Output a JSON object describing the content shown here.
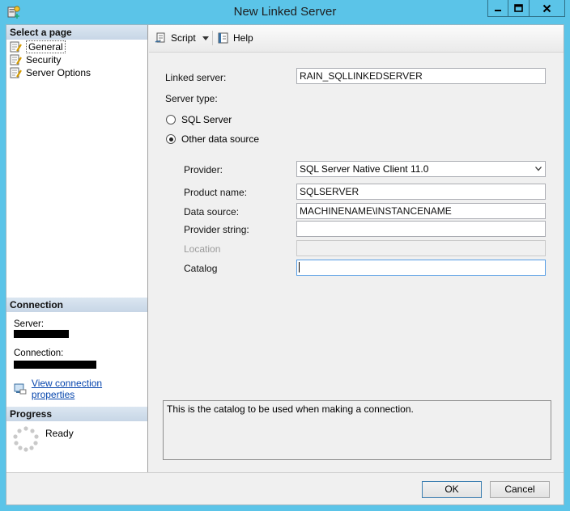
{
  "window": {
    "title": "New Linked Server"
  },
  "left_pane": {
    "select_page_header": "Select a page",
    "pages": [
      {
        "label": "General",
        "selected": true
      },
      {
        "label": "Security",
        "selected": false
      },
      {
        "label": "Server Options",
        "selected": false
      }
    ],
    "connection_header": "Connection",
    "server_label": "Server:",
    "connection_label": "Connection:",
    "view_connection_properties": "View connection properties",
    "progress_header": "Progress",
    "progress_status": "Ready"
  },
  "toolbar": {
    "script_label": "Script",
    "help_label": "Help"
  },
  "form": {
    "linked_server_label": "Linked server:",
    "linked_server_value": "RAIN_SQLLINKEDSERVER",
    "server_type_label": "Server type:",
    "sql_server_radio_label": "SQL Server",
    "other_data_source_radio_label": "Other data source",
    "selected_server_type": "Other data source",
    "provider_label": "Provider:",
    "provider_value": "SQL Server Native Client 11.0",
    "product_name_label": "Product name:",
    "product_name_value": "SQLSERVER",
    "data_source_label": "Data source:",
    "data_source_value": "MACHINENAME\\INSTANCENAME",
    "provider_string_label": "Provider string:",
    "provider_string_value": "",
    "location_label": "Location",
    "location_value": "",
    "catalog_label": "Catalog",
    "catalog_value": ""
  },
  "description": "This is the catalog to be used when making a connection.",
  "buttons": {
    "ok": "OK",
    "cancel": "Cancel"
  },
  "icons": {
    "app": "linked-server-icon",
    "page": "wrench-page-icon",
    "script": "script-icon",
    "help": "help-icon",
    "connection": "connection-properties-icon",
    "progress": "spinner-icon"
  },
  "colors": {
    "title_bar": "#5bc4e8",
    "section_header": "#c7d6e6",
    "link": "#0645ad"
  }
}
